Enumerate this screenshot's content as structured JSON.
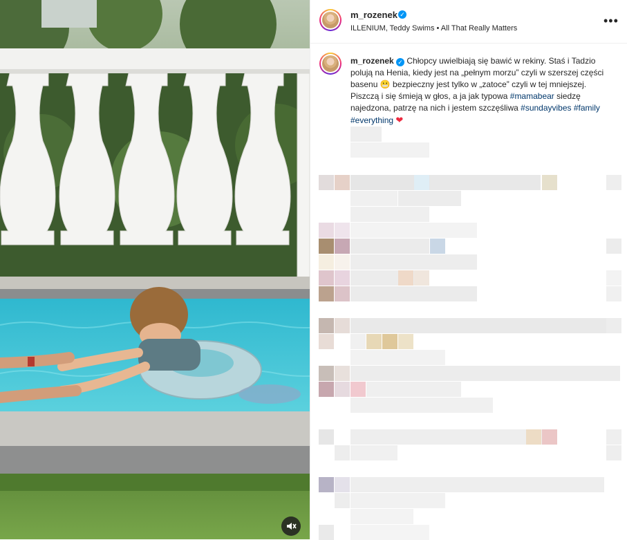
{
  "post": {
    "username": "m_rozenek",
    "audio": "ILLENIUM, Teddy Swims • All That Really Matters",
    "verified_glyph": "✓",
    "more_icon": "more-horizontal-icon",
    "media_controls": {
      "mute_icon": "speaker-muted-icon"
    }
  },
  "caption": {
    "username": "m_rozenek",
    "text_part1": "Chłopcy uwielbiają się bawić w rekiny. Staś i Tadzio polują na Henia, kiedy jest na „pełnym morzu” czyli w szerszej części basenu",
    "emoji": "😬",
    "text_part2": "bezpieczny jest tylko w „zatoce” czyli w tej mniejszej. Piszczą i się śmieją w głos, a ja jak typowa",
    "tag1": "#mamabear",
    "text_part3": "siedzę najedzona, patrzę na nich i jestem szczęśliwa",
    "tag2": "#sundayvibes",
    "tag3": "#family",
    "tag4": "#everything",
    "heart": "❤"
  },
  "colors": {
    "link": "#00376b",
    "verified": "#0095f6",
    "heart": "#ed2a3f",
    "pool": "#3cc3d8",
    "divider": "#efefef"
  }
}
